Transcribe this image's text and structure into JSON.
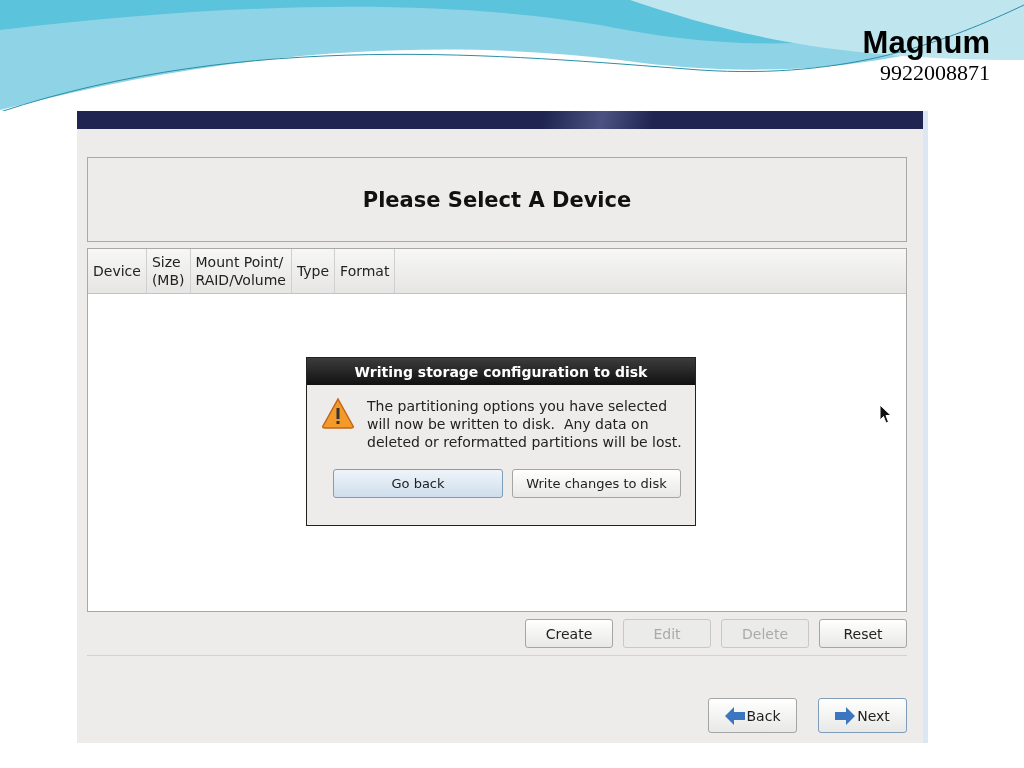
{
  "brand": {
    "name": "Magnum",
    "phone": "9922008871"
  },
  "heading": "Please Select A Device",
  "table": {
    "columns": [
      {
        "label": "Device"
      },
      {
        "label": "Size\n(MB)"
      },
      {
        "label": "Mount Point/\nRAID/Volume"
      },
      {
        "label": "Type"
      },
      {
        "label": "Format"
      }
    ]
  },
  "dialog": {
    "title": "Writing storage configuration to disk",
    "message": "The partitioning options you have selected\nwill now be written to disk.  Any data on\ndeleted or reformatted partitions will be lost.",
    "buttons": [
      {
        "label": "Go back",
        "focused": true
      },
      {
        "label": "Write changes to disk",
        "focused": false
      }
    ]
  },
  "actions": [
    {
      "label": "Create",
      "disabled": false
    },
    {
      "label": "Edit",
      "disabled": true
    },
    {
      "label": "Delete",
      "disabled": true
    },
    {
      "label": "Reset",
      "disabled": false
    }
  ],
  "nav": [
    {
      "label": "Back",
      "kind": "back"
    },
    {
      "label": "Next",
      "kind": "next"
    }
  ]
}
